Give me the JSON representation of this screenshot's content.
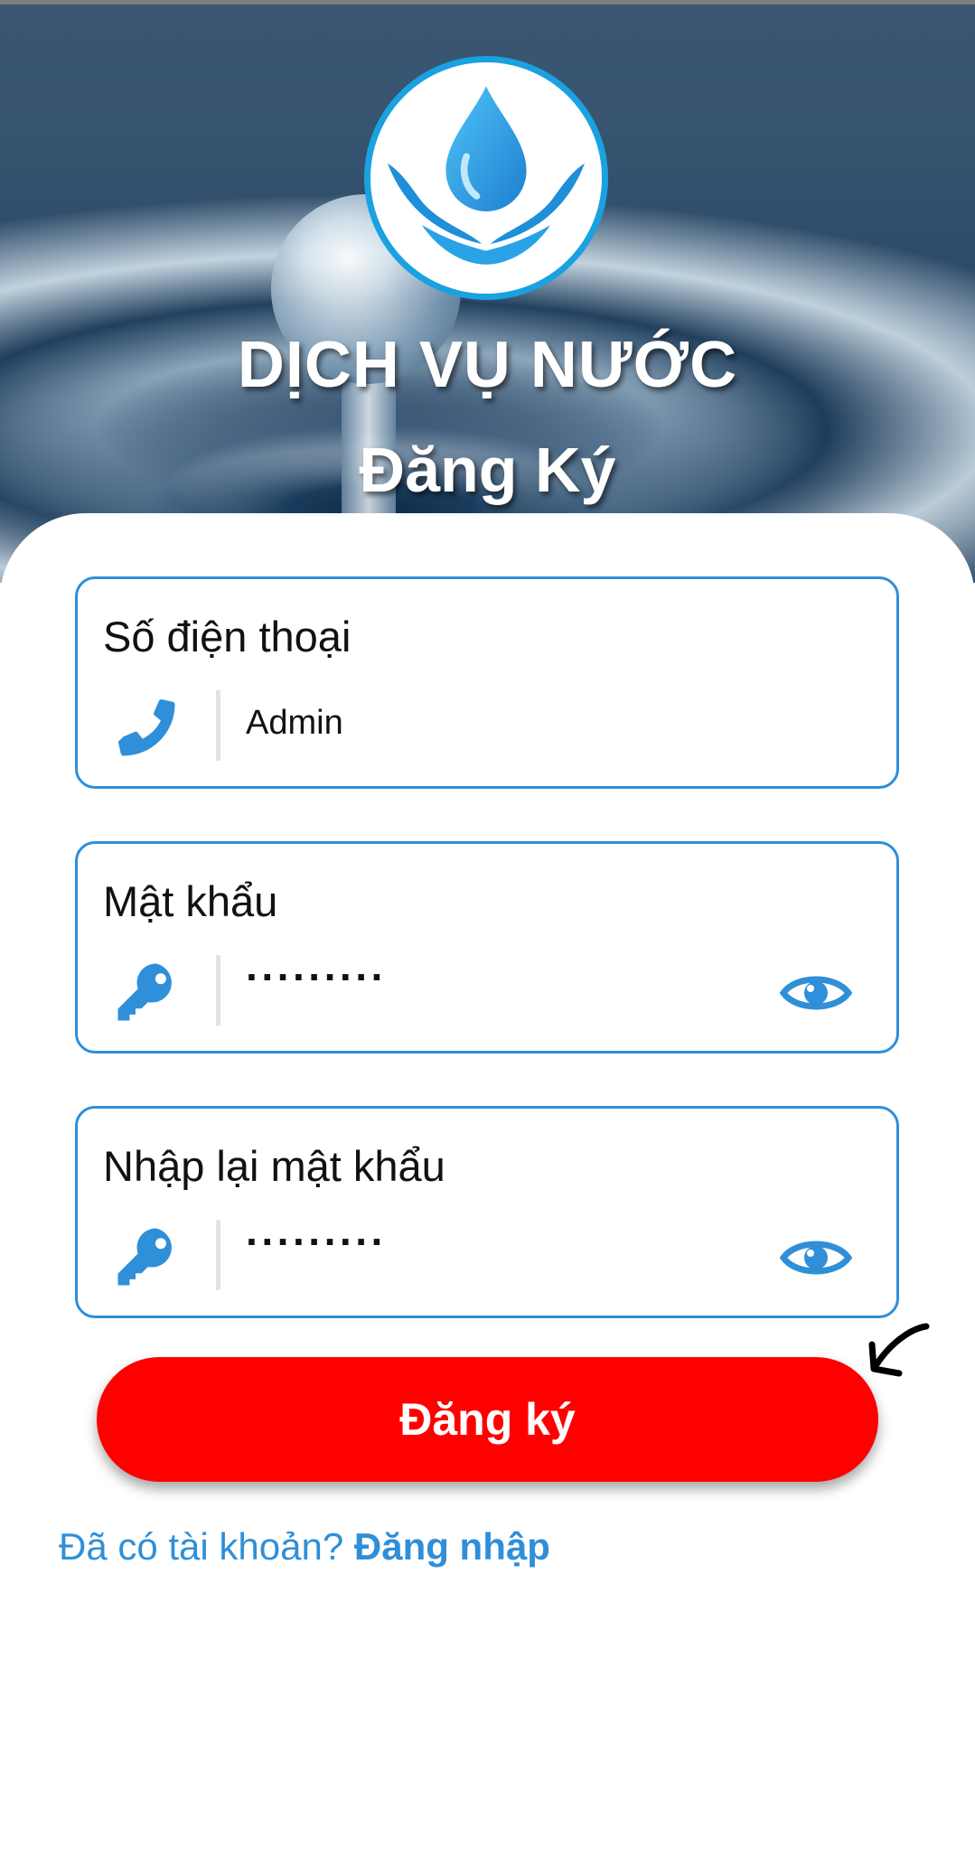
{
  "header": {
    "app_title": "DỊCH VỤ NƯỚC",
    "page_title": "Đăng Ký",
    "logo": "water-hands-logo"
  },
  "form": {
    "phone": {
      "label": "Số điện thoại",
      "value": "Admin",
      "icon": "phone-icon"
    },
    "password": {
      "label": "Mật khẩu",
      "value": "·········",
      "icon": "key-icon",
      "toggle_icon": "eye-icon"
    },
    "confirm_password": {
      "label": "Nhập lại mật khẩu",
      "value": "·········",
      "icon": "key-icon",
      "toggle_icon": "eye-icon"
    },
    "submit_label": "Đăng ký"
  },
  "footer": {
    "prompt": "Đã có tài khoản?",
    "login_link": "Đăng nhập"
  },
  "colors": {
    "accent_blue": "#2f8fd8",
    "logo_blue": "#1aa1e0",
    "submit_red": "#ff0000"
  }
}
